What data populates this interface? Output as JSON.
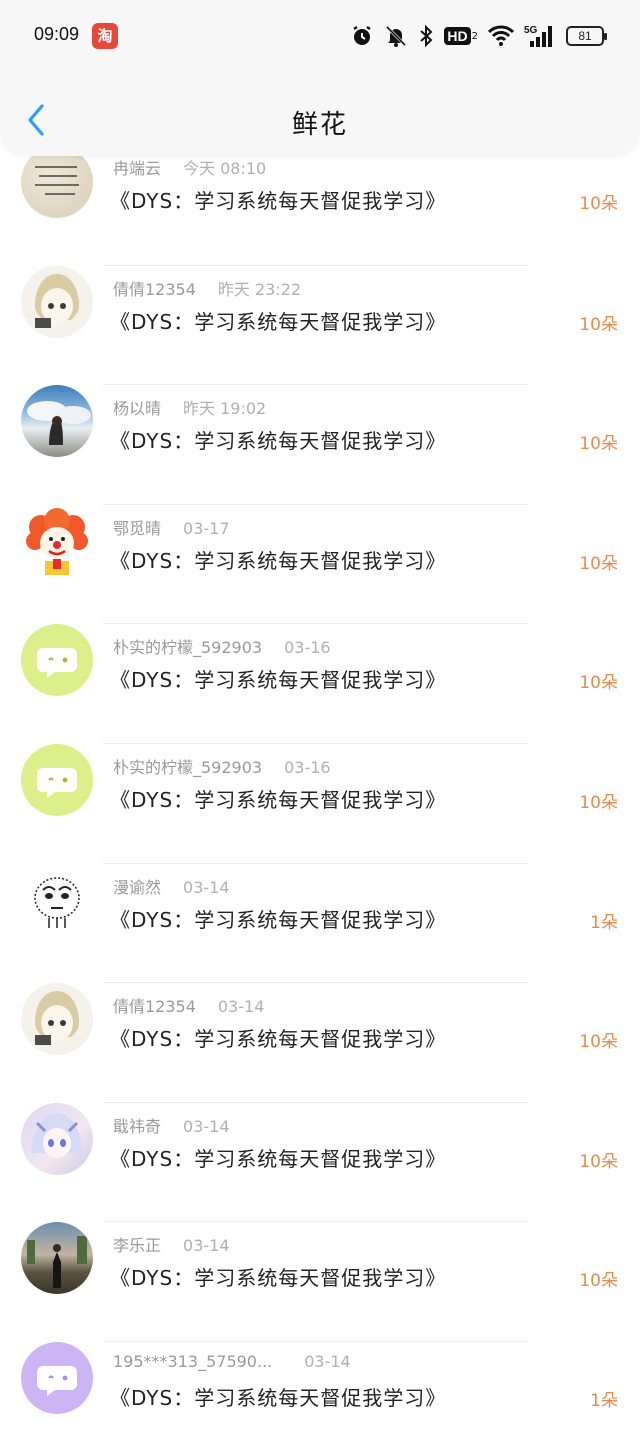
{
  "status_bar": {
    "time": "09:09",
    "app_icon": "淘",
    "hd_label": "HD",
    "hd_sub": "2",
    "network": "5G",
    "battery": "81"
  },
  "nav": {
    "title": "鲜花"
  },
  "colors": {
    "accent_count": "#e98a4b",
    "back_arrow": "#2f9bff"
  },
  "gifts": [
    {
      "avatar": "stone-text",
      "name": "冉端云",
      "time": "今天 08:10",
      "content": "《DYS：学习系统每天督促我学习》",
      "count": "10朵"
    },
    {
      "avatar": "manga-girl",
      "name": "倩倩12354",
      "time": "昨天 23:22",
      "content": "《DYS：学习系统每天督促我学习》",
      "count": "10朵"
    },
    {
      "avatar": "sky-girl",
      "name": "杨以晴",
      "time": "昨天 19:02",
      "content": "《DYS：学习系统每天督促我学习》",
      "count": "10朵"
    },
    {
      "avatar": "clown",
      "name": "鄂觅晴",
      "time": "03-17",
      "content": "《DYS：学习系统每天督促我学习》",
      "count": "10朵"
    },
    {
      "avatar": "chat-green",
      "name": "朴实的柠檬_592903",
      "time": "03-16",
      "content": "《DYS：学习系统每天督促我学习》",
      "count": "10朵"
    },
    {
      "avatar": "chat-green",
      "name": "朴实的柠檬_592903",
      "time": "03-16",
      "content": "《DYS：学习系统每天督促我学习》",
      "count": "10朵"
    },
    {
      "avatar": "sketch-face",
      "name": "漫谕然",
      "time": "03-14",
      "content": "《DYS：学习系统每天督促我学习》",
      "count": "1朵"
    },
    {
      "avatar": "manga-girl",
      "name": "倩倩12354",
      "time": "03-14",
      "content": "《DYS：学习系统每天督促我学习》",
      "count": "10朵"
    },
    {
      "avatar": "anime-girl",
      "name": "戢祎奇",
      "time": "03-14",
      "content": "《DYS：学习系统每天督促我学习》",
      "count": "10朵"
    },
    {
      "avatar": "photo-girl",
      "name": "李乐正",
      "time": "03-14",
      "content": "《DYS：学习系统每天督促我学习》",
      "count": "10朵"
    },
    {
      "avatar": "chat-purple",
      "name": "195***313_57590...",
      "time": "03-14",
      "content": "《DYS：学习系统每天督促我学习》",
      "count": "1朵"
    }
  ]
}
